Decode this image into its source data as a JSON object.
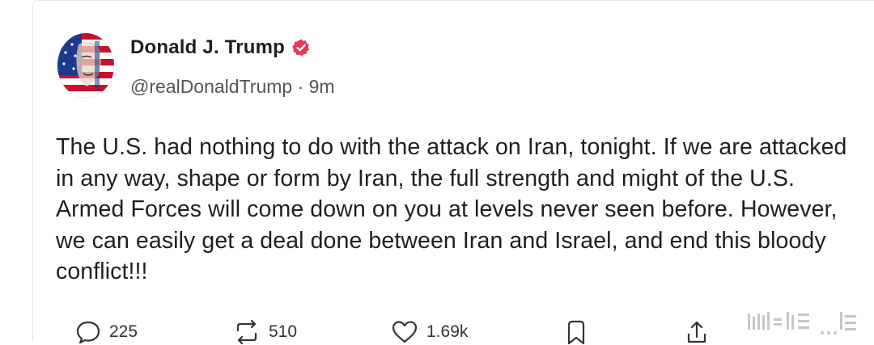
{
  "post": {
    "author_name": "Donald J. Trump",
    "handle": "@realDonaldTrump",
    "separator": "·",
    "time": "9m",
    "text": "The U.S. had nothing to do with the attack on Iran, tonight. If we are attacked in any way, shape or form by Iran, the full strength and might of the U.S. Armed Forces will come down on you at levels never seen before. However, we can easily get a deal done between Iran and Israel, and end this bloody conflict!!!"
  },
  "actions": {
    "replies": "225",
    "reposts": "510",
    "likes": "1.69k"
  },
  "icons": {
    "verified": "verified-badge-icon",
    "reply": "reply-icon",
    "repost": "repost-icon",
    "like": "heart-icon",
    "bookmark": "bookmark-icon",
    "share": "share-icon"
  },
  "colors": {
    "verified_badge": "#e8395b",
    "text": "#1f1f1f",
    "muted": "#555555"
  }
}
